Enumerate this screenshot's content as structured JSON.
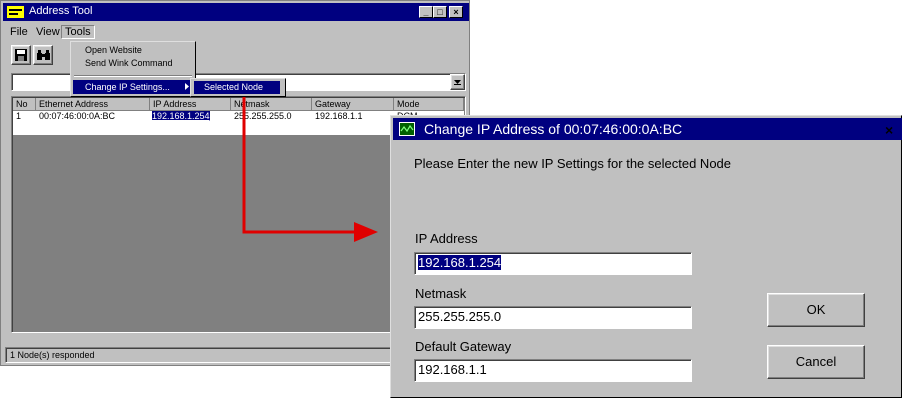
{
  "main_window": {
    "title": "Address Tool",
    "menu": [
      "File",
      "View",
      "Tools"
    ],
    "tools_menu": {
      "items": [
        "Open Website",
        "Send Wink Command",
        "Change IP Settings..."
      ],
      "submenu": [
        "Selected Node"
      ]
    },
    "list": {
      "columns": [
        "No",
        "Ethernet Address",
        "IP Address",
        "Netmask",
        "Gateway",
        "Mode"
      ],
      "rows": [
        {
          "no": "1",
          "ethernet": "00:07:46:00:0A:BC",
          "ip": "192.168.1.254",
          "netmask": "255.255.255.0",
          "gateway": "192.168.1.1",
          "mode": "DCM"
        }
      ]
    },
    "status": "1 Node(s) responded"
  },
  "dialog": {
    "title": "Change IP Address of 00:07:46:00:0A:BC",
    "instruction": "Please Enter the new IP Settings for the selected Node",
    "ip_label": "IP Address",
    "ip_value": "192.168.1.254",
    "netmask_label": "Netmask",
    "netmask_value": "255.255.255.0",
    "gateway_label": "Default Gateway",
    "gateway_value": "192.168.1.1",
    "ok_label": "OK",
    "cancel_label": "Cancel"
  },
  "colors": {
    "titlebar": "#000080",
    "face": "#c0c0c0",
    "arrow": "#e00000"
  },
  "icons": [
    "app-icon",
    "save-icon",
    "binoculars-icon",
    "dialog-network-icon",
    "combo-dropdown-icon",
    "submenu-arrow-icon"
  ]
}
